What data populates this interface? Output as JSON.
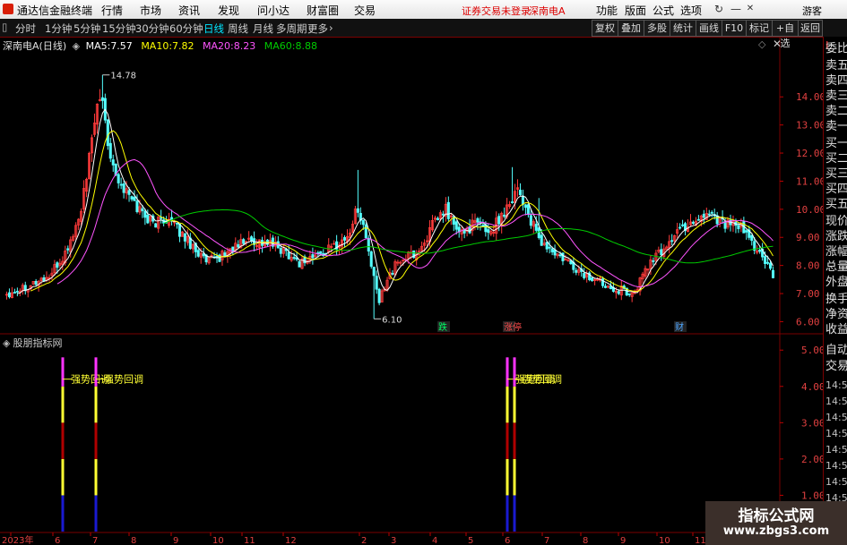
{
  "menubar": {
    "app_title": "通达信金融终端",
    "items": [
      "行情",
      "市场",
      "资讯",
      "发现",
      "问小达",
      "财富圈",
      "交易"
    ],
    "notice": "证券交易未登录",
    "stock_name": "深南电A",
    "right_items": [
      "功能",
      "版面",
      "公式",
      "选项"
    ],
    "guest": "游客"
  },
  "periods": [
    "分时",
    "1分钟",
    "5分钟",
    "15分钟",
    "30分钟",
    "60分钟",
    "日线",
    "周线",
    "月线",
    "多周期",
    "更多"
  ],
  "active_period": "日线",
  "right_buttons": [
    "复权",
    "叠加",
    "多股",
    "统计",
    "画线",
    "F10",
    "标记",
    "+自选",
    "返回"
  ],
  "chart_header": {
    "stock": "深南电A(日线)",
    "ma5_label": "MA5:",
    "ma5": "7.57",
    "ma10_label": "MA10:",
    "ma10": "7.82",
    "ma20_label": "MA20:",
    "ma20": "8.23",
    "ma60_label": "MA60:",
    "ma60": "8.88"
  },
  "indicator_pane": {
    "title": "股朋指标网",
    "signal_text": "强势回调"
  },
  "side_panel": {
    "header": "L",
    "labels": [
      "委比",
      "卖五",
      "卖四",
      "卖三",
      "卖二",
      "卖一",
      "买一",
      "买二",
      "买三",
      "买四",
      "买五",
      "现价",
      "涨跌",
      "涨幅",
      "总量",
      "外盘",
      "换手",
      "净资",
      "收益",
      "自动",
      "交易"
    ],
    "times": [
      "14:55",
      "14:55",
      "14:55",
      "14:56",
      "14:56",
      "14:56",
      "14:56",
      "14:56"
    ]
  },
  "colors": {
    "up": "#ff3b3b",
    "down": "#54ffff",
    "ma5": "#ffffff",
    "ma10": "#ffff00",
    "ma20": "#ff55ff",
    "ma60": "#00cc00",
    "grid": "#7a0000"
  },
  "watermark": {
    "line1": "指标公式网",
    "line2": "www.zbgs3.com"
  },
  "chart_data": {
    "type": "candlestick",
    "title": "深南电A(日线)",
    "ylim": [
      5.6,
      15.6
    ],
    "y_ticks": [
      "14.00",
      "13.00",
      "12.00",
      "11.00",
      "10.00",
      "9.00",
      "8.00",
      "7.00",
      "6.00"
    ],
    "high_label": "14.78",
    "low_label": "6.10",
    "annotations": [
      "跌",
      "涨停",
      "财"
    ],
    "x_tick_labels": [
      "2023年",
      "6",
      "7",
      "8",
      "9",
      "10",
      "11",
      "12",
      "2",
      "3",
      "4",
      "5",
      "6",
      "7",
      "8",
      "9",
      "10",
      "11"
    ],
    "close_anchors": [
      [
        0,
        7.0
      ],
      [
        8,
        7.3
      ],
      [
        16,
        7.6
      ],
      [
        22,
        8.4
      ],
      [
        27,
        9.6
      ],
      [
        30,
        11.0
      ],
      [
        33,
        13.3
      ],
      [
        36,
        13.9
      ],
      [
        38,
        12.4
      ],
      [
        42,
        11.0
      ],
      [
        48,
        10.2
      ],
      [
        55,
        9.5
      ],
      [
        60,
        9.7
      ],
      [
        64,
        9.3
      ],
      [
        70,
        8.7
      ],
      [
        75,
        8.1
      ],
      [
        80,
        8.3
      ],
      [
        90,
        8.9
      ],
      [
        98,
        8.8
      ],
      [
        105,
        8.5
      ],
      [
        110,
        8.1
      ],
      [
        120,
        8.5
      ],
      [
        128,
        9.0
      ],
      [
        132,
        10.1
      ],
      [
        135,
        9.0
      ],
      [
        138,
        7.5
      ],
      [
        140,
        6.7
      ],
      [
        143,
        7.6
      ],
      [
        148,
        8.2
      ],
      [
        155,
        8.5
      ],
      [
        160,
        9.4
      ],
      [
        165,
        10.0
      ],
      [
        170,
        9.1
      ],
      [
        176,
        9.5
      ],
      [
        182,
        9.2
      ],
      [
        188,
        10.1
      ],
      [
        192,
        10.8
      ],
      [
        196,
        9.8
      ],
      [
        200,
        8.9
      ],
      [
        206,
        8.4
      ],
      [
        212,
        8.0
      ],
      [
        218,
        7.6
      ],
      [
        224,
        7.4
      ],
      [
        230,
        7.15
      ],
      [
        236,
        7.0
      ],
      [
        240,
        7.9
      ],
      [
        246,
        8.5
      ],
      [
        252,
        9.2
      ],
      [
        258,
        9.6
      ],
      [
        264,
        9.9
      ],
      [
        270,
        9.5
      ],
      [
        276,
        9.3
      ],
      [
        282,
        8.6
      ],
      [
        288,
        7.6
      ]
    ],
    "indicator": {
      "ylim": [
        0,
        5.4
      ],
      "y_ticks": [
        "5.00",
        "4.00",
        "3.00",
        "2.00",
        "1.00"
      ],
      "signals": [
        {
          "x": 70,
          "value": 4.8,
          "label": "强势回调"
        },
        {
          "x": 107,
          "value": 4.8,
          "label": "强势回调"
        },
        {
          "x": 566,
          "value": 4.8,
          "label": "强势回调"
        },
        {
          "x": 574,
          "value": 4.8,
          "label": "强势回调"
        }
      ]
    }
  }
}
